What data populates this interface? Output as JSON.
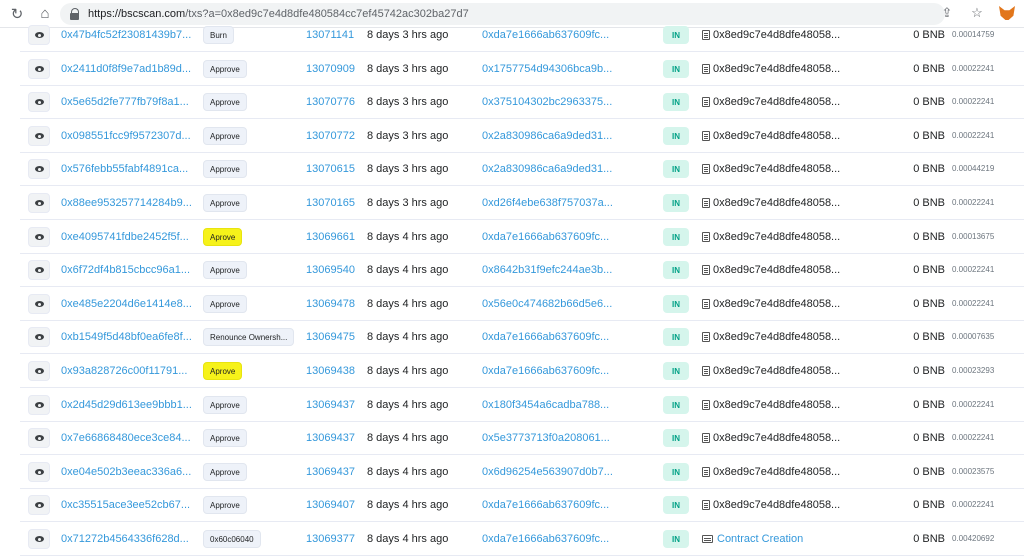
{
  "browser": {
    "url_host": "https://bscscan.com",
    "url_path": "/txs?a=0x8ed9c7e4d8dfe480584cc7ef45742ac302ba27d7"
  },
  "transactions": [
    {
      "hash": "0x47b4fc52f23081439b7...",
      "method": "Burn",
      "highlight": false,
      "block": "13071141",
      "age": "8 days 3 hrs ago",
      "from": "0xda7e1666ab637609fc...",
      "direction": "IN",
      "to": "0x8ed9c7e4d8dfe48058...",
      "to_type": "contract-doc",
      "value": "0 BNB",
      "fee": "0.00014759"
    },
    {
      "hash": "0x2411d0f8f9e7ad1b89d...",
      "method": "Approve",
      "highlight": false,
      "block": "13070909",
      "age": "8 days 3 hrs ago",
      "from": "0x1757754d94306bca9b...",
      "direction": "IN",
      "to": "0x8ed9c7e4d8dfe48058...",
      "to_type": "contract-doc",
      "value": "0 BNB",
      "fee": "0.00022241"
    },
    {
      "hash": "0x5e65d2fe777fb79f8a1...",
      "method": "Approve",
      "highlight": false,
      "block": "13070776",
      "age": "8 days 3 hrs ago",
      "from": "0x375104302bc2963375...",
      "direction": "IN",
      "to": "0x8ed9c7e4d8dfe48058...",
      "to_type": "contract-doc",
      "value": "0 BNB",
      "fee": "0.00022241"
    },
    {
      "hash": "0x098551fcc9f9572307d...",
      "method": "Approve",
      "highlight": false,
      "block": "13070772",
      "age": "8 days 3 hrs ago",
      "from": "0x2a830986ca6a9ded31...",
      "direction": "IN",
      "to": "0x8ed9c7e4d8dfe48058...",
      "to_type": "contract-doc",
      "value": "0 BNB",
      "fee": "0.00022241"
    },
    {
      "hash": "0x576febb55fabf4891ca...",
      "method": "Approve",
      "highlight": false,
      "block": "13070615",
      "age": "8 days 3 hrs ago",
      "from": "0x2a830986ca6a9ded31...",
      "direction": "IN",
      "to": "0x8ed9c7e4d8dfe48058...",
      "to_type": "contract-doc",
      "value": "0 BNB",
      "fee": "0.00044219"
    },
    {
      "hash": "0x88ee953257714284b9...",
      "method": "Approve",
      "highlight": false,
      "block": "13070165",
      "age": "8 days 3 hrs ago",
      "from": "0xd26f4ebe638f757037a...",
      "direction": "IN",
      "to": "0x8ed9c7e4d8dfe48058...",
      "to_type": "contract-doc",
      "value": "0 BNB",
      "fee": "0.00022241"
    },
    {
      "hash": "0xe4095741fdbe2452f5f...",
      "method": "Aprove",
      "highlight": true,
      "block": "13069661",
      "age": "8 days 4 hrs ago",
      "from": "0xda7e1666ab637609fc...",
      "direction": "IN",
      "to": "0x8ed9c7e4d8dfe48058...",
      "to_type": "contract-doc",
      "value": "0 BNB",
      "fee": "0.00013675"
    },
    {
      "hash": "0x6f72df4b815cbcc96a1...",
      "method": "Approve",
      "highlight": false,
      "block": "13069540",
      "age": "8 days 4 hrs ago",
      "from": "0x8642b31f9efc244ae3b...",
      "direction": "IN",
      "to": "0x8ed9c7e4d8dfe48058...",
      "to_type": "contract-doc",
      "value": "0 BNB",
      "fee": "0.00022241"
    },
    {
      "hash": "0xe485e2204d6e1414e8...",
      "method": "Approve",
      "highlight": false,
      "block": "13069478",
      "age": "8 days 4 hrs ago",
      "from": "0x56e0c474682b66d5e6...",
      "direction": "IN",
      "to": "0x8ed9c7e4d8dfe48058...",
      "to_type": "contract-doc",
      "value": "0 BNB",
      "fee": "0.00022241"
    },
    {
      "hash": "0xb1549f5d48bf0ea6fe8f...",
      "method": "Renounce Ownersh...",
      "highlight": false,
      "block": "13069475",
      "age": "8 days 4 hrs ago",
      "from": "0xda7e1666ab637609fc...",
      "direction": "IN",
      "to": "0x8ed9c7e4d8dfe48058...",
      "to_type": "contract-doc",
      "value": "0 BNB",
      "fee": "0.00007635"
    },
    {
      "hash": "0x93a828726c00f11791...",
      "method": "Aprove",
      "highlight": true,
      "block": "13069438",
      "age": "8 days 4 hrs ago",
      "from": "0xda7e1666ab637609fc...",
      "direction": "IN",
      "to": "0x8ed9c7e4d8dfe48058...",
      "to_type": "contract-doc",
      "value": "0 BNB",
      "fee": "0.00023293"
    },
    {
      "hash": "0x2d45d29d613ee9bbb1...",
      "method": "Approve",
      "highlight": false,
      "block": "13069437",
      "age": "8 days 4 hrs ago",
      "from": "0x180f3454a6cadba788...",
      "direction": "IN",
      "to": "0x8ed9c7e4d8dfe48058...",
      "to_type": "contract-doc",
      "value": "0 BNB",
      "fee": "0.00022241"
    },
    {
      "hash": "0x7e66868480ece3ce84...",
      "method": "Approve",
      "highlight": false,
      "block": "13069437",
      "age": "8 days 4 hrs ago",
      "from": "0x5e3773713f0a208061...",
      "direction": "IN",
      "to": "0x8ed9c7e4d8dfe48058...",
      "to_type": "contract-doc",
      "value": "0 BNB",
      "fee": "0.00022241"
    },
    {
      "hash": "0xe04e502b3eeac336a6...",
      "method": "Approve",
      "highlight": false,
      "block": "13069437",
      "age": "8 days 4 hrs ago",
      "from": "0x6d96254e563907d0b7...",
      "direction": "IN",
      "to": "0x8ed9c7e4d8dfe48058...",
      "to_type": "contract-doc",
      "value": "0 BNB",
      "fee": "0.00023575"
    },
    {
      "hash": "0xc35515ace3ee52cb67...",
      "method": "Approve",
      "highlight": false,
      "block": "13069407",
      "age": "8 days 4 hrs ago",
      "from": "0xda7e1666ab637609fc...",
      "direction": "IN",
      "to": "0x8ed9c7e4d8dfe48058...",
      "to_type": "contract-doc",
      "value": "0 BNB",
      "fee": "0.00022241"
    },
    {
      "hash": "0x71272b4564336f628d...",
      "method": "0x60c06040",
      "highlight": false,
      "block": "13069377",
      "age": "8 days 4 hrs ago",
      "from": "0xda7e1666ab637609fc...",
      "direction": "IN",
      "to": "Contract Creation",
      "to_type": "contract-creation",
      "value": "0 BNB",
      "fee": "0.00420692"
    }
  ]
}
